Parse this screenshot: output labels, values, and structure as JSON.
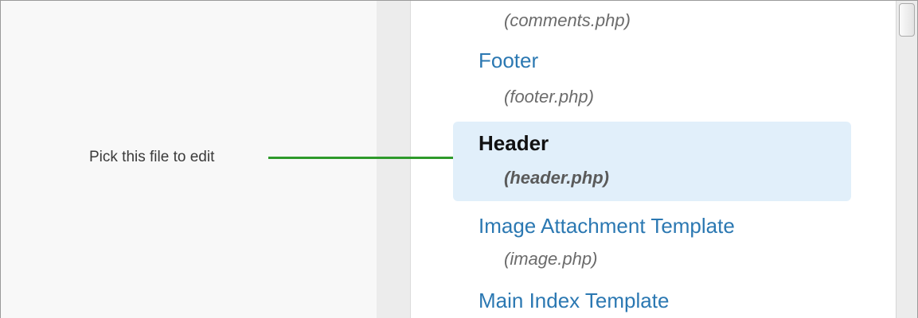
{
  "annotation": {
    "text": "Pick this file to edit"
  },
  "files": [
    {
      "title": "",
      "path": "(comments.php)"
    },
    {
      "title": "Footer",
      "path": "(footer.php)"
    },
    {
      "title": "Header",
      "path": "(header.php)",
      "selected": true
    },
    {
      "title": "Image Attachment Template",
      "path": "(image.php)"
    },
    {
      "title": "Main Index Template",
      "path": ""
    }
  ],
  "colors": {
    "link": "#2b78b2",
    "selected_bg": "#e1effa",
    "annotation_line": "#2e9a2b"
  }
}
